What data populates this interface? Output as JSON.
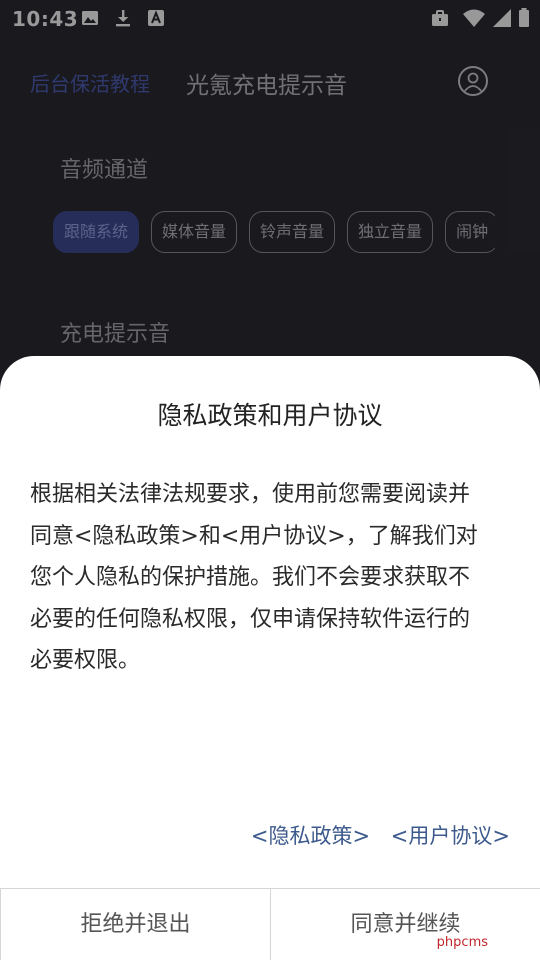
{
  "status_bar": {
    "time": "10:43",
    "left_icons": [
      "image-icon",
      "download-icon",
      "text-a-icon"
    ],
    "right_icons": [
      "briefcase-icon",
      "wifi-icon",
      "signal-icon",
      "battery-icon"
    ]
  },
  "app": {
    "tab_left": "后台保活教程",
    "title": "光氪充电提示音",
    "sections": [
      {
        "title": "音频通道"
      },
      {
        "title": "充电提示音"
      }
    ],
    "channel_chips": [
      "跟随系统",
      "媒体音量",
      "铃声音量",
      "独立音量",
      "闹钟"
    ],
    "active_chip": "跟随系统",
    "colors": {
      "background": "#2b2b33",
      "accent": "#3f4b93"
    }
  },
  "dialog": {
    "title": "隐私政策和用户协议",
    "lines": [
      "根据相关法律法规要求，使用前您需要阅读并",
      "同意<隐私政策>和<用户协议>，了解我们对",
      "您个人隐私的保护措施。我们不会要求获取不",
      "必要的任何隐私权限，仅申请保持软件运行的",
      "必要权限。"
    ],
    "link_privacy": "<隐私政策>",
    "link_agreement": "<用户协议>",
    "reject_button": "拒绝并退出",
    "accept_button": "同意并继续"
  },
  "watermark": "phpcms"
}
